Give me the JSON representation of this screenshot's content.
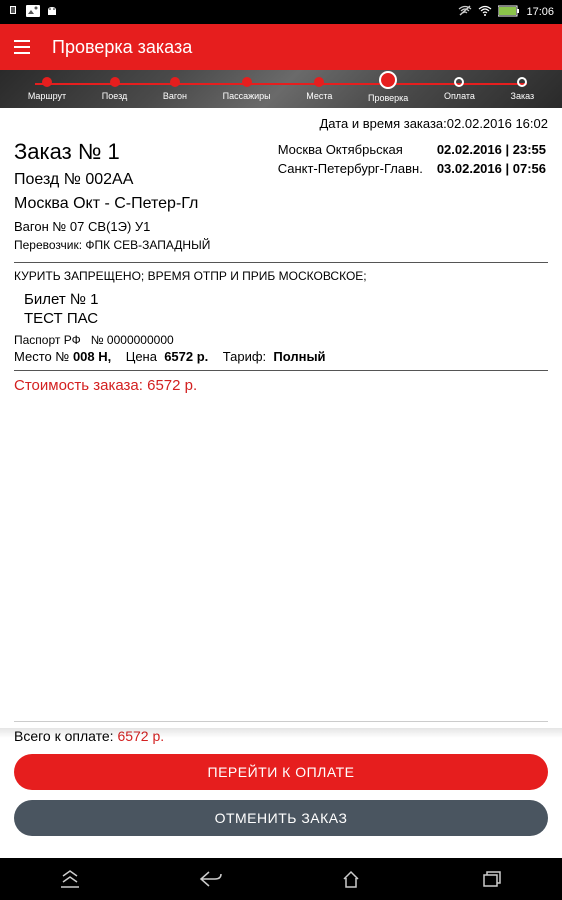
{
  "status": {
    "time": "17:06"
  },
  "header": {
    "title": "Проверка заказа"
  },
  "stepper": {
    "steps": [
      {
        "label": "Маршрут"
      },
      {
        "label": "Поезд"
      },
      {
        "label": "Вагон"
      },
      {
        "label": "Пассажиры"
      },
      {
        "label": "Места"
      },
      {
        "label": "Проверка"
      },
      {
        "label": "Оплата"
      },
      {
        "label": "Заказ"
      }
    ]
  },
  "order": {
    "date_label": "Дата и время заказа:",
    "date_value": "02.02.2016 16:02",
    "title": "Заказ № 1",
    "train": "Поезд № 002АА",
    "route": "Москва Окт - С-Петер-Гл",
    "wagon": "Вагон № 07  СВ(1Э) У1",
    "carrier": "Перевозчик: ФПК СЕВ-ЗАПАДНЫЙ",
    "departure_city": "Москва Октябрьская",
    "departure_dt": "02.02.2016 | 23:55",
    "arrival_city": "Санкт-Петербург-Главн.",
    "arrival_dt": "03.02.2016 | 07:56",
    "notes": "КУРИТЬ ЗАПРЕЩЕНО; ВРЕМЯ ОТПР И ПРИБ МОСКОВСКОЕ;"
  },
  "ticket": {
    "title": "Билет № 1",
    "name": "ТЕСТ  ПАС",
    "passport_label": "Паспорт РФ",
    "passport_num": "№ 0000000000",
    "seat_label": "Место №",
    "seat_value": "008 Н,",
    "price_label": "Цена",
    "price_value": "6572 р.",
    "tariff_label": "Тариф:",
    "tariff_value": "Полный"
  },
  "cost": {
    "label": "Стоимость заказа: ",
    "value": "6572 р."
  },
  "footer": {
    "total_label": "Всего к оплате: ",
    "total_value": "6572 р.",
    "pay_button": "ПЕРЕЙТИ К ОПЛАТЕ",
    "cancel_button": "ОТМЕНИТЬ ЗАКАЗ"
  }
}
